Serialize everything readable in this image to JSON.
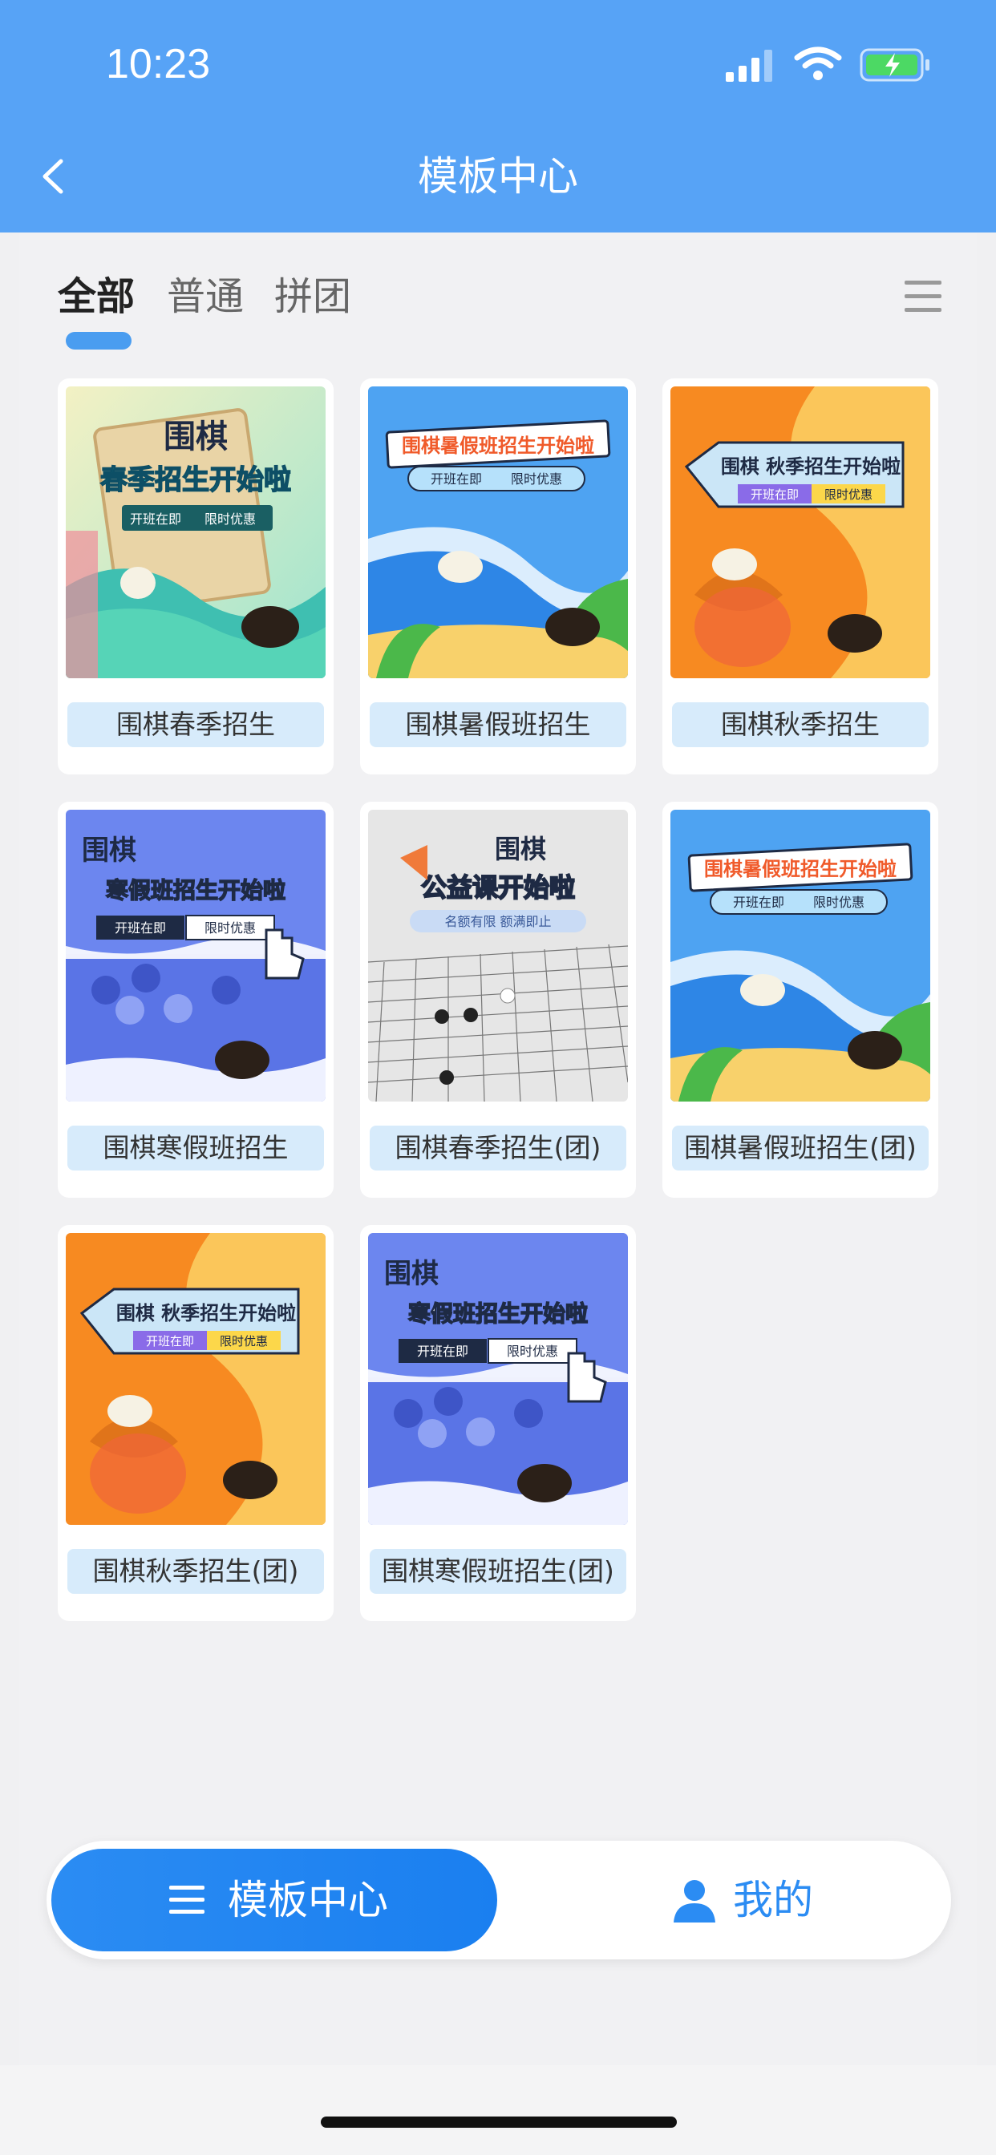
{
  "status": {
    "time": "10:23"
  },
  "header": {
    "title": "模板中心"
  },
  "tabs": [
    {
      "label": "全部",
      "active": true
    },
    {
      "label": "普通",
      "active": false
    },
    {
      "label": "拼团",
      "active": false
    }
  ],
  "templates": [
    {
      "label": "围棋春季招生",
      "poster": {
        "title1": "围棋",
        "title2": "春季招生开始啦",
        "tag1": "开班在即",
        "tag2": "限时优惠"
      }
    },
    {
      "label": "围棋暑假班招生",
      "poster": {
        "title1": "围棋暑假班招生开始啦",
        "tag1": "开班在即",
        "tag2": "限时优惠"
      }
    },
    {
      "label": "围棋秋季招生",
      "poster": {
        "title1": "围棋 秋季招生开始啦",
        "tag1": "开班在即",
        "tag2": "限时优惠"
      }
    },
    {
      "label": "围棋寒假班招生",
      "poster": {
        "title1": "围棋",
        "title2": "寒假班招生开始啦",
        "tag1": "开班在即",
        "tag2": "限时优惠"
      }
    },
    {
      "label": "围棋春季招生(团)",
      "poster": {
        "title1": "围棋",
        "title2": "公益课开始啦",
        "tag1": "名额有限 额满即止"
      }
    },
    {
      "label": "围棋暑假班招生(团)",
      "poster": {
        "title1": "围棋暑假班招生开始啦",
        "tag1": "开班在即",
        "tag2": "限时优惠"
      }
    },
    {
      "label": "围棋秋季招生(团)",
      "poster": {
        "title1": "围棋 秋季招生开始啦",
        "tag1": "开班在即",
        "tag2": "限时优惠"
      }
    },
    {
      "label": "围棋寒假班招生(团)",
      "poster": {
        "title1": "围棋",
        "title2": "寒假班招生开始啦",
        "tag1": "开班在即",
        "tag2": "限时优惠"
      }
    }
  ],
  "bottom_nav": {
    "templates_label": "模板中心",
    "mine_label": "我的"
  },
  "colors": {
    "header": "#57a3f6",
    "accent": "#2b8cf3",
    "label_bg": "#d7ebfb"
  }
}
